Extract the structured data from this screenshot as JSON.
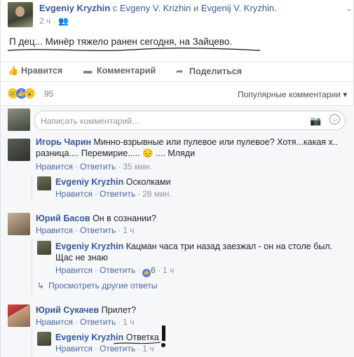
{
  "post": {
    "author": "Evgeniy Kryzhin",
    "with_word": "с",
    "tagged_1": "Evgeny V. Krizhin",
    "and_word": "и",
    "tagged_2": "Evgenij V. Kryzhin.",
    "time": "2 ч",
    "privacy_icon": "friends-icon",
    "text": "П   дец... Минёр тяжело ранен сегодня, на Зайцево."
  },
  "actions": {
    "like": "Нравится",
    "comment": "Комментарий",
    "share": "Поделиться"
  },
  "reactions": {
    "count": "95",
    "sort_label": "Популярные комментарии ▾"
  },
  "composer": {
    "placeholder": "Написать комментарий..."
  },
  "comments": [
    {
      "author": "Игорь Чарин",
      "text_line1": "Минно-взрывные или пулевое или пулевое? Хотя...какая х..",
      "text_line2": "разница.... Перемирие..... 😔 .... Мляди",
      "like": "Нравится",
      "reply": "Ответить",
      "time": "35 мин.",
      "replies": [
        {
          "author": "Evgeniy Kryzhin",
          "text": "Осколками",
          "like": "Нравится",
          "reply": "Ответить",
          "time": "28 мин."
        }
      ]
    },
    {
      "author": "Юрий Басов",
      "text_line1": "Он в сознании?",
      "like": "Нравится",
      "reply": "Ответить",
      "time": "1 ч",
      "replies": [
        {
          "author": "Evgeniy Kryzhin",
          "text": "Кацман часа три назад заезжал - он на столе был.",
          "text_line2": "Щас не знаю",
          "like": "Нравится",
          "reply": "Ответить",
          "likes": "6",
          "time": "1 ч"
        }
      ],
      "more_replies": "Просмотреть другие ответы"
    },
    {
      "author": "Юрий Сукачев",
      "text_line1": "Прилет?",
      "like": "Нравится",
      "reply": "Ответить",
      "time": "1 ч",
      "replies": [
        {
          "author": "Evgeniy Kryzhin",
          "text": "Ответка",
          "like": "Нравится",
          "reply": "Ответить",
          "time": "1 ч"
        }
      ]
    }
  ],
  "colors": {
    "link": "#365899",
    "meta": "#90949c",
    "like_blue": "#4c7cf3"
  }
}
